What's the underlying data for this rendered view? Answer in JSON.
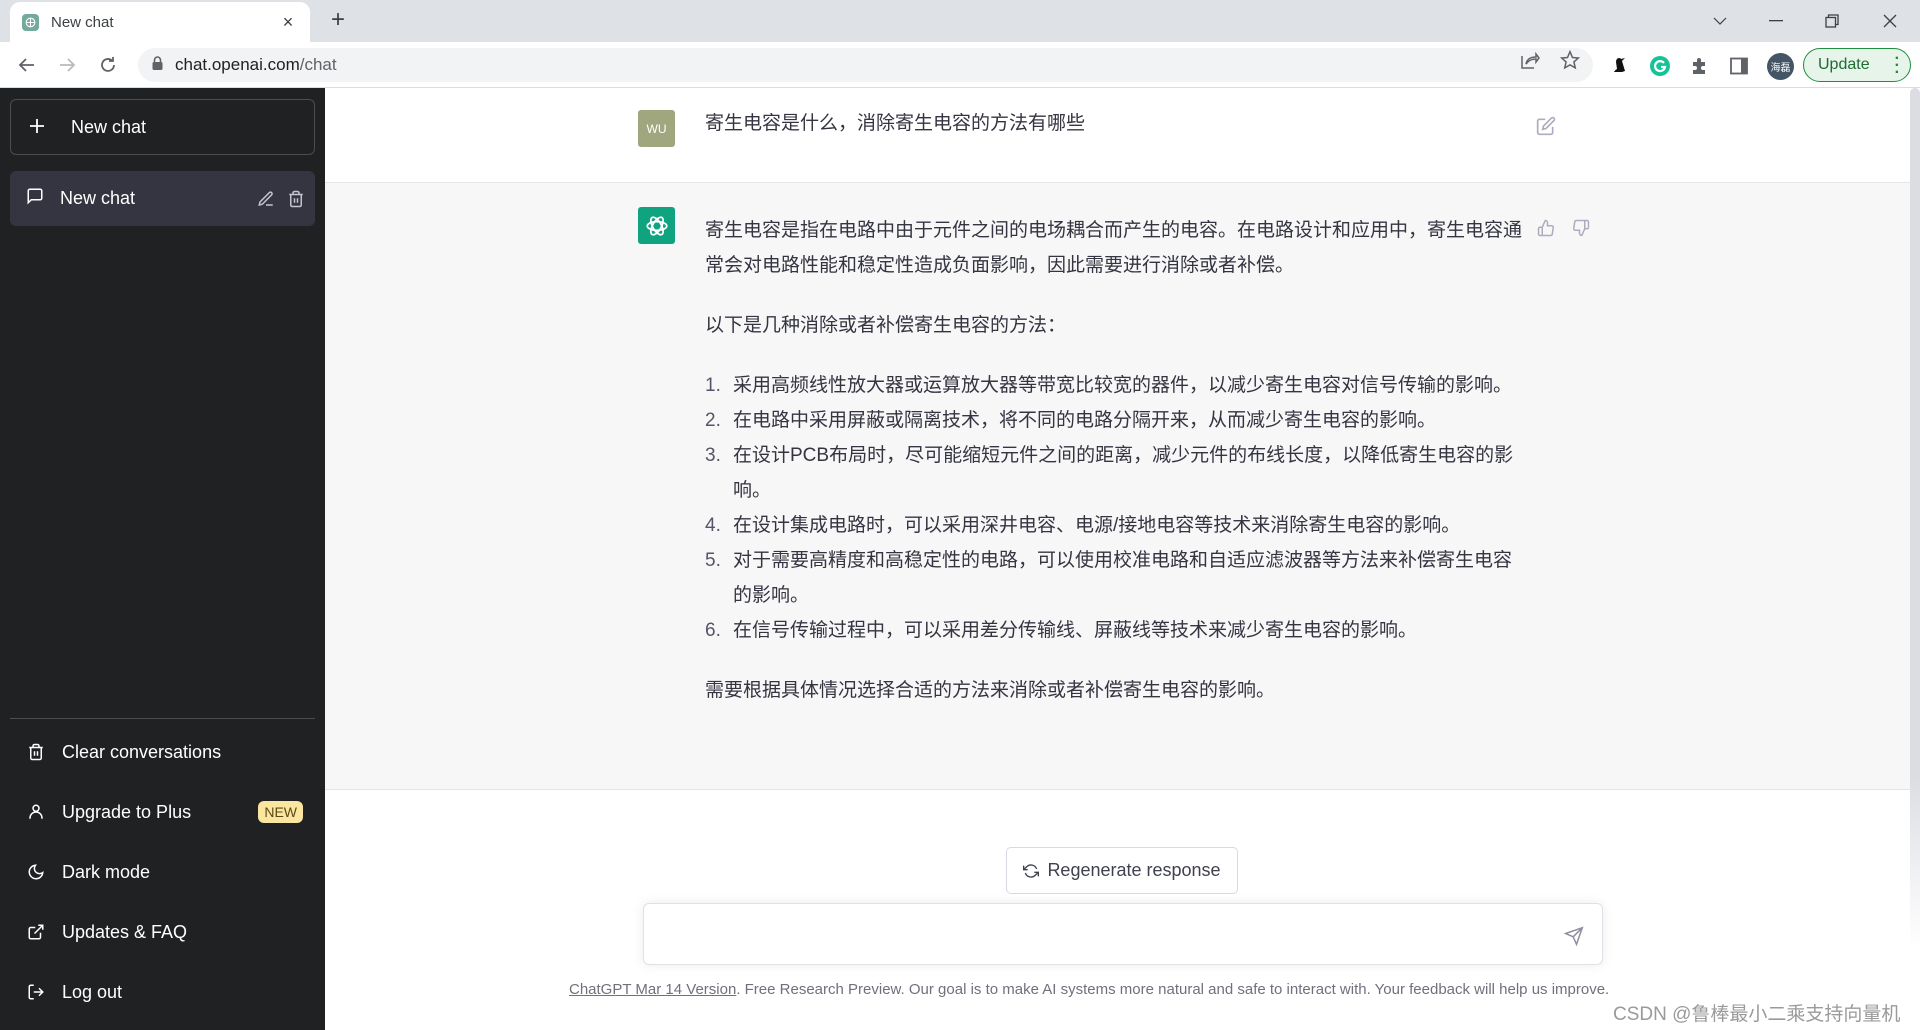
{
  "browser": {
    "tab": {
      "title": "New chat",
      "close_icon": "×"
    },
    "new_tab_icon": "+",
    "url_domain": "chat.openai.com",
    "url_path": "/chat",
    "profile_label": "海磊",
    "update_label": "Update",
    "window_controls": {
      "tab_search": "⌄",
      "minimize": "—",
      "restore": "❐",
      "close": "✕"
    }
  },
  "sidebar": {
    "new_chat_label": "New chat",
    "conversations": [
      {
        "label": "New chat"
      }
    ],
    "items": [
      {
        "label": "Clear conversations",
        "icon": "trash-icon"
      },
      {
        "label": "Upgrade to Plus",
        "icon": "user-icon",
        "badge": "NEW"
      },
      {
        "label": "Dark mode",
        "icon": "moon-icon"
      },
      {
        "label": "Updates & FAQ",
        "icon": "external-link-icon"
      },
      {
        "label": "Log out",
        "icon": "logout-icon"
      }
    ]
  },
  "chat": {
    "user": {
      "avatar_initials": "WU",
      "message": "寄生电容是什么，消除寄生电容的方法有哪些"
    },
    "assistant": {
      "intro": "寄生电容是指在电路中由于元件之间的电场耦合而产生的电容。在电路设计和应用中，寄生电容通常会对电路性能和稳定性造成负面影响，因此需要进行消除或者补偿。",
      "lead": "以下是几种消除或者补偿寄生电容的方法：",
      "list": [
        {
          "num": "1.",
          "text": "采用高频线性放大器或运算放大器等带宽比较宽的器件，以减少寄生电容对信号传输的影响。"
        },
        {
          "num": "2.",
          "text": "在电路中采用屏蔽或隔离技术，将不同的电路分隔开来，从而减少寄生电容的影响。"
        },
        {
          "num": "3.",
          "text": "在设计PCB布局时，尽可能缩短元件之间的距离，减少元件的布线长度，以降低寄生电容的影响。"
        },
        {
          "num": "4.",
          "text": "在设计集成电路时，可以采用深井电容、电源/接地电容等技术来消除寄生电容的影响。"
        },
        {
          "num": "5.",
          "text": "对于需要高精度和高稳定性的电路，可以使用校准电路和自适应滤波器等方法来补偿寄生电容的影响。"
        },
        {
          "num": "6.",
          "text": "在信号传输过程中，可以采用差分传输线、屏蔽线等技术来减少寄生电容的影响。"
        }
      ],
      "conclusion": "需要根据具体情况选择合适的方法来消除或者补偿寄生电容的影响。"
    },
    "regenerate_label": "Regenerate response",
    "input_value": "",
    "input_placeholder": ""
  },
  "footer": {
    "version_link": "ChatGPT Mar 14 Version",
    "text": ". Free Research Preview. Our goal is to make AI systems more natural and safe to interact with. Your feedback will help us improve."
  },
  "watermark": "CSDN @鲁棒最小二乘支持向量机",
  "colors": {
    "sidebar_bg": "#202123",
    "active_conv_bg": "#343541",
    "assistant_row_bg": "#f7f7f8",
    "brand_green": "#10a37f",
    "user_avatar": "#a0a77f",
    "badge_bg": "#fae69e"
  }
}
